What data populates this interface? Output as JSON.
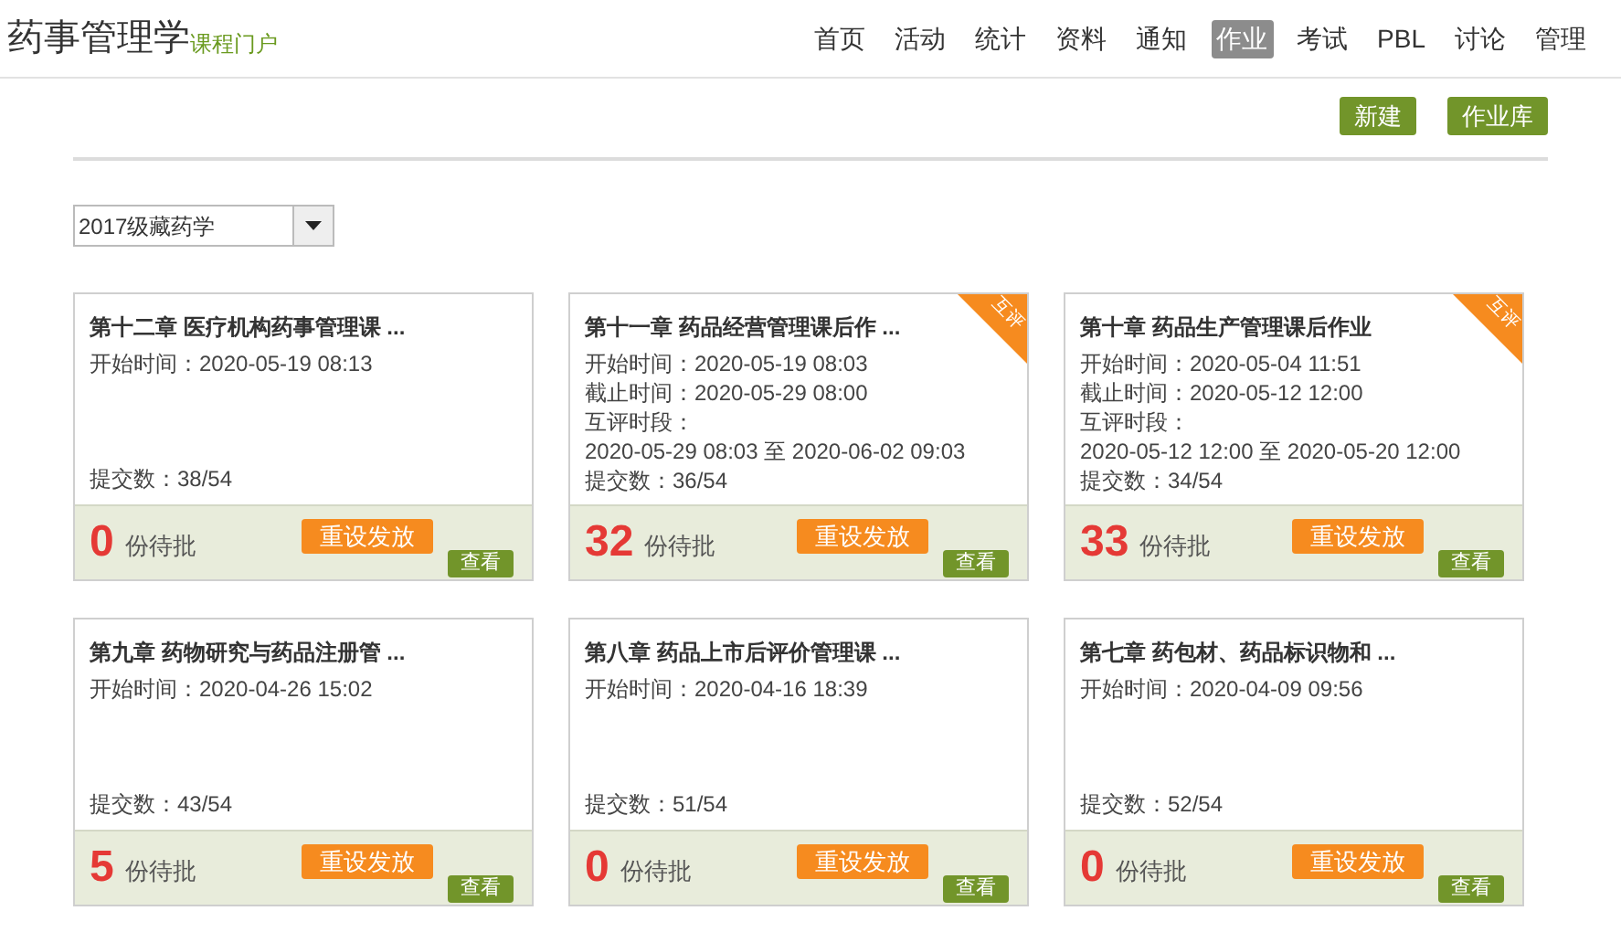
{
  "header": {
    "title": "药事管理学",
    "subtitle": "课程门户",
    "nav": [
      {
        "label": "首页",
        "selected": false
      },
      {
        "label": "活动",
        "selected": false
      },
      {
        "label": "统计",
        "selected": false
      },
      {
        "label": "资料",
        "selected": false
      },
      {
        "label": "通知",
        "selected": false
      },
      {
        "label": "作业",
        "selected": true
      },
      {
        "label": "考试",
        "selected": false
      },
      {
        "label": "PBL",
        "selected": false
      },
      {
        "label": "讨论",
        "selected": false
      },
      {
        "label": "管理",
        "selected": false
      }
    ]
  },
  "actions": [
    "新建",
    "作业库"
  ],
  "class_select": {
    "value": "2017级藏药学"
  },
  "assignments": [
    {
      "title": "第十二章 医疗机构药事管理课 ...",
      "peer_review": false,
      "lines": [
        {
          "label": "开始时间：",
          "value": "2020-05-19 08:13"
        }
      ],
      "submitted_label": "提交数：",
      "submitted": "38/54",
      "pending": "0",
      "pending_label": "份待批",
      "reset": "重设发放",
      "view": "查看"
    },
    {
      "title": "第十一章 药品经营管理课后作 ...",
      "peer_review": true,
      "badge": "互评",
      "lines": [
        {
          "label": "开始时间：",
          "value": "2020-05-19 08:03"
        },
        {
          "label": "截止时间：",
          "value": "2020-05-29 08:00"
        },
        {
          "label": "互评时段：",
          "value": "2020-05-29 08:03 至 2020-06-02 09:03"
        }
      ],
      "submitted_label": "提交数：",
      "submitted": "36/54",
      "pending": "32",
      "pending_label": "份待批",
      "reset": "重设发放",
      "view": "查看"
    },
    {
      "title": "第十章 药品生产管理课后作业",
      "peer_review": true,
      "badge": "互评",
      "lines": [
        {
          "label": "开始时间：",
          "value": "2020-05-04 11:51"
        },
        {
          "label": "截止时间：",
          "value": "2020-05-12 12:00"
        },
        {
          "label": "互评时段：",
          "value": "2020-05-12 12:00 至 2020-05-20 12:00"
        }
      ],
      "submitted_label": "提交数：",
      "submitted": "34/54",
      "pending": "33",
      "pending_label": "份待批",
      "reset": "重设发放",
      "view": "查看"
    },
    {
      "title": "第九章 药物研究与药品注册管 ...",
      "peer_review": false,
      "lines": [
        {
          "label": "开始时间：",
          "value": "2020-04-26 15:02"
        }
      ],
      "submitted_label": "提交数：",
      "submitted": "43/54",
      "pending": "5",
      "pending_label": "份待批",
      "reset": "重设发放",
      "view": "查看"
    },
    {
      "title": "第八章 药品上市后评价管理课 ...",
      "peer_review": false,
      "lines": [
        {
          "label": "开始时间：",
          "value": "2020-04-16 18:39"
        }
      ],
      "submitted_label": "提交数：",
      "submitted": "51/54",
      "pending": "0",
      "pending_label": "份待批",
      "reset": "重设发放",
      "view": "查看"
    },
    {
      "title": "第七章 药包材、药品标识物和 ...",
      "peer_review": false,
      "lines": [
        {
          "label": "开始时间：",
          "value": "2020-04-09 09:56"
        }
      ],
      "submitted_label": "提交数：",
      "submitted": "52/54",
      "pending": "0",
      "pending_label": "份待批",
      "reset": "重设发放",
      "view": "查看"
    }
  ]
}
